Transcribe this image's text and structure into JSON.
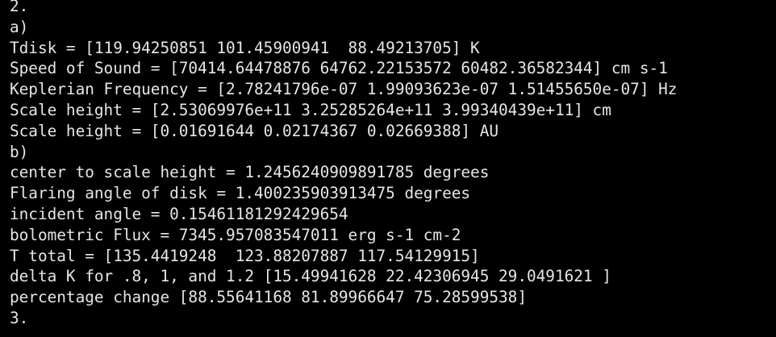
{
  "terminal": {
    "lines": [
      "2.",
      "a)",
      "Tdisk = [119.94250851 101.45900941  88.49213705] K",
      "Speed of Sound = [70414.64478876 64762.22153572 60482.36582344] cm s-1",
      "Keplerian Frequency = [2.78241796e-07 1.99093623e-07 1.51455650e-07] Hz",
      "Scale height = [2.53069976e+11 3.25285264e+11 3.99340439e+11] cm",
      "Scale height = [0.01691644 0.02174367 0.02669388] AU",
      "b)",
      "center to scale height = 1.2456240909891785 degrees",
      "Flaring angle of disk = 1.400235903913475 degrees",
      "incident angle = 0.15461181292429654",
      "bolometric Flux = 7345.957083547011 erg s-1 cm-2",
      "T total = [135.4419248  123.88207887 117.54129915]",
      "delta K for .8, 1, and 1.2 [15.49941628 22.42306945 29.0491621 ]",
      "percentage change [88.55641168 81.89966647 75.28599538]",
      "3."
    ]
  }
}
